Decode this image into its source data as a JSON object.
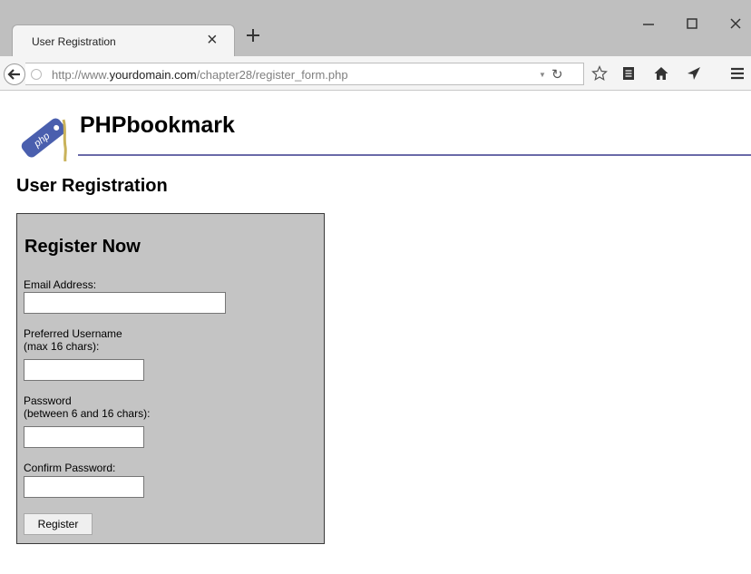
{
  "browser": {
    "tab_title": "User Registration",
    "tab_close_glyph": "×",
    "url_prefix": "http://www.",
    "url_domain": "yourdomain.com",
    "url_path": "/chapter28/register_form.php"
  },
  "site": {
    "logo_text": "php",
    "title": "PHPbookmark"
  },
  "page": {
    "heading": "User Registration"
  },
  "form": {
    "title": "Register Now",
    "email_label": "Email Address:",
    "email_value": "",
    "username_label_line1": "Preferred Username",
    "username_label_line2": "(max 16 chars):",
    "username_value": "",
    "password_label_line1": "Password",
    "password_label_line2": "(between 6 and 16 chars):",
    "password_value": "",
    "confirm_label": "Confirm Password:",
    "confirm_value": "",
    "submit_label": "Register"
  },
  "colors": {
    "header_rule": "#6a6aa8",
    "form_background": "#c4c4c4",
    "logo_tag": "#4a5fae"
  },
  "icons": [
    "back-arrow-icon",
    "globe-icon",
    "reload-icon",
    "star-icon",
    "reading-list-icon",
    "home-icon",
    "send-icon",
    "menu-icon",
    "plus-icon",
    "minimize-icon",
    "maximize-icon",
    "close-icon"
  ]
}
